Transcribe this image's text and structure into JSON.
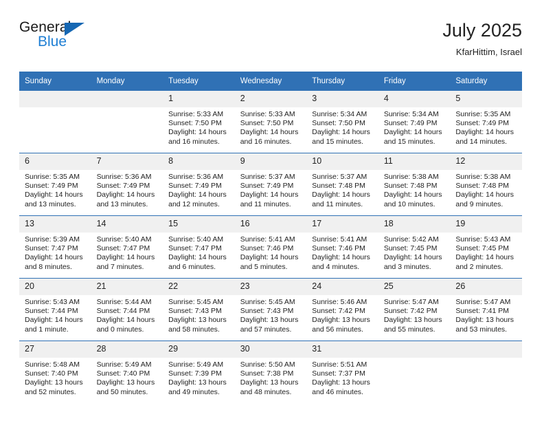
{
  "brand": {
    "name_top": "General",
    "name_bottom": "Blue",
    "triangle_color": "#1567b3",
    "blue_color": "#1f7fd4"
  },
  "header": {
    "title": "July 2025",
    "subtitle": "KfarHittim, Israel"
  },
  "theme": {
    "header_blue": "#3071b5",
    "daynum_bg": "#f0f0f0",
    "text": "#222222"
  },
  "weekdays": [
    "Sunday",
    "Monday",
    "Tuesday",
    "Wednesday",
    "Thursday",
    "Friday",
    "Saturday"
  ],
  "weeks": [
    [
      {
        "day": "",
        "sunrise": "",
        "sunset": "",
        "daylight1": "",
        "daylight2": ""
      },
      {
        "day": "",
        "sunrise": "",
        "sunset": "",
        "daylight1": "",
        "daylight2": ""
      },
      {
        "day": "1",
        "sunrise": "Sunrise: 5:33 AM",
        "sunset": "Sunset: 7:50 PM",
        "daylight1": "Daylight: 14 hours",
        "daylight2": "and 16 minutes."
      },
      {
        "day": "2",
        "sunrise": "Sunrise: 5:33 AM",
        "sunset": "Sunset: 7:50 PM",
        "daylight1": "Daylight: 14 hours",
        "daylight2": "and 16 minutes."
      },
      {
        "day": "3",
        "sunrise": "Sunrise: 5:34 AM",
        "sunset": "Sunset: 7:50 PM",
        "daylight1": "Daylight: 14 hours",
        "daylight2": "and 15 minutes."
      },
      {
        "day": "4",
        "sunrise": "Sunrise: 5:34 AM",
        "sunset": "Sunset: 7:49 PM",
        "daylight1": "Daylight: 14 hours",
        "daylight2": "and 15 minutes."
      },
      {
        "day": "5",
        "sunrise": "Sunrise: 5:35 AM",
        "sunset": "Sunset: 7:49 PM",
        "daylight1": "Daylight: 14 hours",
        "daylight2": "and 14 minutes."
      }
    ],
    [
      {
        "day": "6",
        "sunrise": "Sunrise: 5:35 AM",
        "sunset": "Sunset: 7:49 PM",
        "daylight1": "Daylight: 14 hours",
        "daylight2": "and 13 minutes."
      },
      {
        "day": "7",
        "sunrise": "Sunrise: 5:36 AM",
        "sunset": "Sunset: 7:49 PM",
        "daylight1": "Daylight: 14 hours",
        "daylight2": "and 13 minutes."
      },
      {
        "day": "8",
        "sunrise": "Sunrise: 5:36 AM",
        "sunset": "Sunset: 7:49 PM",
        "daylight1": "Daylight: 14 hours",
        "daylight2": "and 12 minutes."
      },
      {
        "day": "9",
        "sunrise": "Sunrise: 5:37 AM",
        "sunset": "Sunset: 7:49 PM",
        "daylight1": "Daylight: 14 hours",
        "daylight2": "and 11 minutes."
      },
      {
        "day": "10",
        "sunrise": "Sunrise: 5:37 AM",
        "sunset": "Sunset: 7:48 PM",
        "daylight1": "Daylight: 14 hours",
        "daylight2": "and 11 minutes."
      },
      {
        "day": "11",
        "sunrise": "Sunrise: 5:38 AM",
        "sunset": "Sunset: 7:48 PM",
        "daylight1": "Daylight: 14 hours",
        "daylight2": "and 10 minutes."
      },
      {
        "day": "12",
        "sunrise": "Sunrise: 5:38 AM",
        "sunset": "Sunset: 7:48 PM",
        "daylight1": "Daylight: 14 hours",
        "daylight2": "and 9 minutes."
      }
    ],
    [
      {
        "day": "13",
        "sunrise": "Sunrise: 5:39 AM",
        "sunset": "Sunset: 7:47 PM",
        "daylight1": "Daylight: 14 hours",
        "daylight2": "and 8 minutes."
      },
      {
        "day": "14",
        "sunrise": "Sunrise: 5:40 AM",
        "sunset": "Sunset: 7:47 PM",
        "daylight1": "Daylight: 14 hours",
        "daylight2": "and 7 minutes."
      },
      {
        "day": "15",
        "sunrise": "Sunrise: 5:40 AM",
        "sunset": "Sunset: 7:47 PM",
        "daylight1": "Daylight: 14 hours",
        "daylight2": "and 6 minutes."
      },
      {
        "day": "16",
        "sunrise": "Sunrise: 5:41 AM",
        "sunset": "Sunset: 7:46 PM",
        "daylight1": "Daylight: 14 hours",
        "daylight2": "and 5 minutes."
      },
      {
        "day": "17",
        "sunrise": "Sunrise: 5:41 AM",
        "sunset": "Sunset: 7:46 PM",
        "daylight1": "Daylight: 14 hours",
        "daylight2": "and 4 minutes."
      },
      {
        "day": "18",
        "sunrise": "Sunrise: 5:42 AM",
        "sunset": "Sunset: 7:45 PM",
        "daylight1": "Daylight: 14 hours",
        "daylight2": "and 3 minutes."
      },
      {
        "day": "19",
        "sunrise": "Sunrise: 5:43 AM",
        "sunset": "Sunset: 7:45 PM",
        "daylight1": "Daylight: 14 hours",
        "daylight2": "and 2 minutes."
      }
    ],
    [
      {
        "day": "20",
        "sunrise": "Sunrise: 5:43 AM",
        "sunset": "Sunset: 7:44 PM",
        "daylight1": "Daylight: 14 hours",
        "daylight2": "and 1 minute."
      },
      {
        "day": "21",
        "sunrise": "Sunrise: 5:44 AM",
        "sunset": "Sunset: 7:44 PM",
        "daylight1": "Daylight: 14 hours",
        "daylight2": "and 0 minutes."
      },
      {
        "day": "22",
        "sunrise": "Sunrise: 5:45 AM",
        "sunset": "Sunset: 7:43 PM",
        "daylight1": "Daylight: 13 hours",
        "daylight2": "and 58 minutes."
      },
      {
        "day": "23",
        "sunrise": "Sunrise: 5:45 AM",
        "sunset": "Sunset: 7:43 PM",
        "daylight1": "Daylight: 13 hours",
        "daylight2": "and 57 minutes."
      },
      {
        "day": "24",
        "sunrise": "Sunrise: 5:46 AM",
        "sunset": "Sunset: 7:42 PM",
        "daylight1": "Daylight: 13 hours",
        "daylight2": "and 56 minutes."
      },
      {
        "day": "25",
        "sunrise": "Sunrise: 5:47 AM",
        "sunset": "Sunset: 7:42 PM",
        "daylight1": "Daylight: 13 hours",
        "daylight2": "and 55 minutes."
      },
      {
        "day": "26",
        "sunrise": "Sunrise: 5:47 AM",
        "sunset": "Sunset: 7:41 PM",
        "daylight1": "Daylight: 13 hours",
        "daylight2": "and 53 minutes."
      }
    ],
    [
      {
        "day": "27",
        "sunrise": "Sunrise: 5:48 AM",
        "sunset": "Sunset: 7:40 PM",
        "daylight1": "Daylight: 13 hours",
        "daylight2": "and 52 minutes."
      },
      {
        "day": "28",
        "sunrise": "Sunrise: 5:49 AM",
        "sunset": "Sunset: 7:40 PM",
        "daylight1": "Daylight: 13 hours",
        "daylight2": "and 50 minutes."
      },
      {
        "day": "29",
        "sunrise": "Sunrise: 5:49 AM",
        "sunset": "Sunset: 7:39 PM",
        "daylight1": "Daylight: 13 hours",
        "daylight2": "and 49 minutes."
      },
      {
        "day": "30",
        "sunrise": "Sunrise: 5:50 AM",
        "sunset": "Sunset: 7:38 PM",
        "daylight1": "Daylight: 13 hours",
        "daylight2": "and 48 minutes."
      },
      {
        "day": "31",
        "sunrise": "Sunrise: 5:51 AM",
        "sunset": "Sunset: 7:37 PM",
        "daylight1": "Daylight: 13 hours",
        "daylight2": "and 46 minutes."
      },
      {
        "day": "",
        "sunrise": "",
        "sunset": "",
        "daylight1": "",
        "daylight2": ""
      },
      {
        "day": "",
        "sunrise": "",
        "sunset": "",
        "daylight1": "",
        "daylight2": ""
      }
    ]
  ]
}
